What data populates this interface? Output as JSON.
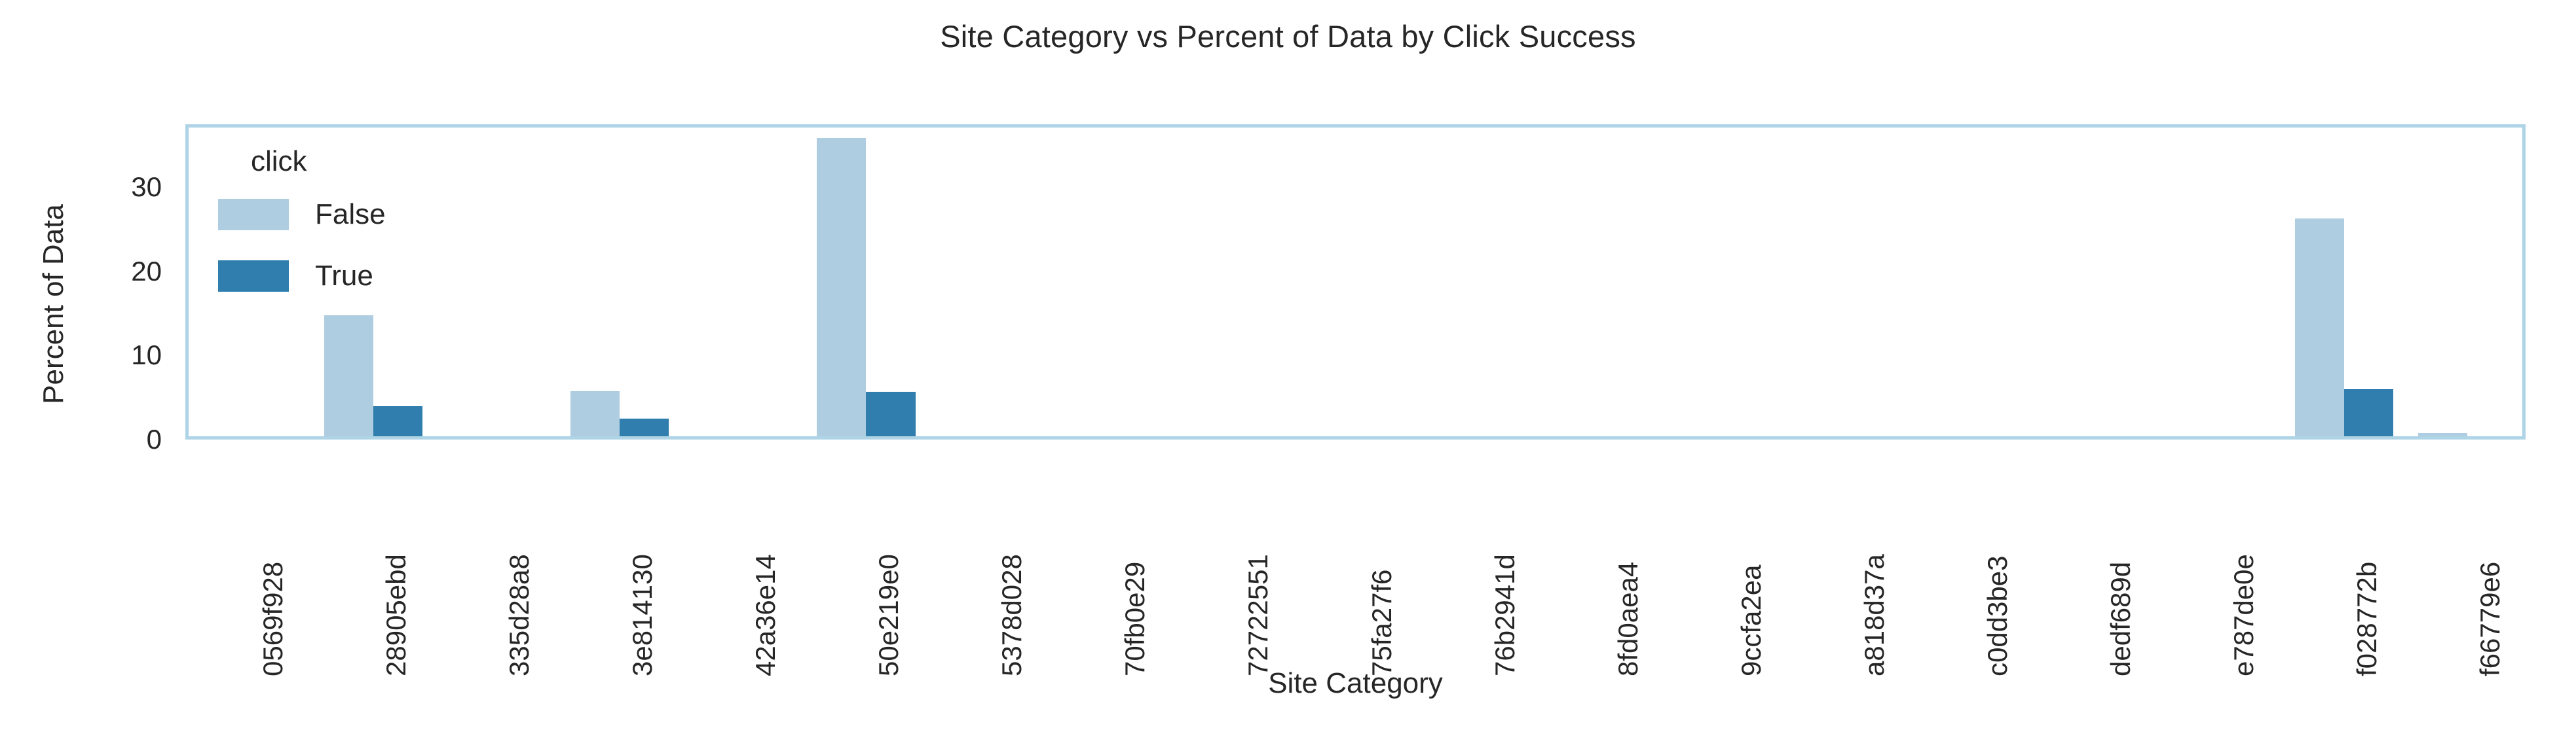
{
  "chart_data": {
    "type": "bar",
    "title": "Site Category vs Percent of Data by Click Success",
    "xlabel": "Site Category",
    "ylabel": "Percent of Data",
    "grid": false,
    "legend_position": "upper-left-inside",
    "legend_title": "click",
    "ylim": [
      0,
      37.5
    ],
    "yticks": [
      0,
      10,
      20,
      30
    ],
    "ytick_labels": [
      "0",
      "10",
      "20",
      "30"
    ],
    "categories": [
      "0569f928",
      "28905ebd",
      "335d28a8",
      "3e814130",
      "42a36e14",
      "50e219e0",
      "5378d028",
      "70fb0e29",
      "72722551",
      "75fa27f6",
      "76b2941d",
      "8fd0aea4",
      "9ccfa2ea",
      "a818d37a",
      "c0dd3be3",
      "dedf689d",
      "e787de0e",
      "f028772b",
      "f66779e6"
    ],
    "series": [
      {
        "name": "False",
        "color": "#aecde0",
        "values": [
          0,
          14.4,
          0,
          5.4,
          0,
          35.5,
          0,
          0,
          0,
          0,
          0,
          0,
          0,
          0,
          0,
          0,
          0,
          25.9,
          0.4
        ]
      },
      {
        "name": "True",
        "color": "#2f7ead",
        "values": [
          0,
          3.6,
          0,
          2.1,
          0,
          5.3,
          0,
          0,
          0,
          0,
          0,
          0,
          0,
          0,
          0,
          0,
          0,
          5.6,
          0
        ]
      }
    ]
  },
  "legend": {
    "title": "click",
    "entries": [
      {
        "label": "False",
        "color": "#aecde0"
      },
      {
        "label": "True",
        "color": "#2f7ead"
      }
    ]
  },
  "colors": {
    "false_bar": "#aecde0",
    "true_bar": "#2f7ead",
    "frame": "#aed4e6",
    "text": "#262626",
    "background": "#ffffff"
  }
}
